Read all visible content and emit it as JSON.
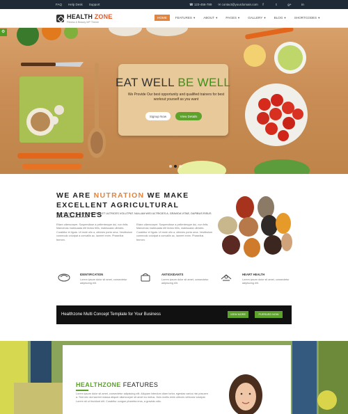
{
  "topbar": {
    "links": [
      "FAQ",
      "Help Desk",
      "Support"
    ],
    "phone": "123-456-789",
    "email": "contact@yourdomain.com",
    "social": [
      "f",
      "t",
      "g+",
      "in"
    ]
  },
  "brand": {
    "name_a": "HEALTH ",
    "name_b": "ZONE",
    "tagline": "Fitness & Beauty WP Theme"
  },
  "menu": [
    {
      "label": "HOME",
      "active": true
    },
    {
      "label": "FEATURES",
      "active": false
    },
    {
      "label": "ABOUT",
      "active": false
    },
    {
      "label": "PAGES",
      "active": false
    },
    {
      "label": "GALLERY",
      "active": false
    },
    {
      "label": "BLOG",
      "active": false
    },
    {
      "label": "SHORTCODES",
      "active": false
    }
  ],
  "hero": {
    "title_a": "EAT WELL ",
    "title_b": "BE WELL",
    "subtitle": "We Provide Our best opportunity and qualified trainers for best workout yourself as you want",
    "btn_show": "Signup Now",
    "btn_details": "View Details"
  },
  "about": {
    "title_a": "WE ARE ",
    "title_b": "NUTRATION",
    "title_c": " WE MAKE EXCELLENT AGRICULTURAL MACHINES",
    "lead": "CUM SOCIIS NATOQUE PENATIBUS ET ULTRICES VOLUTPAT. NULLAM WISI ULTRICIES A, GRAVIDA VITAE, DAPIBUS RISUS ANTE SODALES LECTUS.",
    "col1": "Etiam ullamcorper. Suspendisse a pellentesque dui, non felis. Maecenas malesuada elit lectus felis, malesuada ultricies. Curabitur et ligula. Ut mole olio a, ultricies porta urna. Vestibulum commodo volutpat a convallis ac, laoreet enim. Phasellus fermen.",
    "col2": "Etiam ullamcorper. Suspendisse a pellentesque dui, non felis. Maecenas malesuada elit lectus felis, malesuada ultricies. Curabitur et ligula. Ut mole olio a, ultricies porta urna. Vestibulum commodo volutpat a convallis ac, laoreet enim. Phasellus fermen."
  },
  "features": [
    {
      "title": "IDENTIFICATION",
      "text": "Lorem ipsum dolor sit amet, consectetur adipiscing elit."
    },
    {
      "title": "ANTIOXIDANTS",
      "text": "Lorem ipsum dolor sit amet, consectetur adipiscing elit."
    },
    {
      "title": "HEART HEALTH",
      "text": "Lorem ipsum dolor sit amet, consectetur adipiscing elit."
    }
  ],
  "cta": {
    "text": "Healthzone Multi Concept Template for Your Business",
    "btn_view": "VIEW MORE",
    "btn_purchase": "PURSUED NOW"
  },
  "bottom": {
    "title_a": "HEALTHZONE",
    "title_b": " FEATURES",
    "text": "Lorem ipsum dolor sit amet, consectetur adipiscing elit. Aliquam interdum diam tortor, egestas varius nisl posuere a. Sed nec dui laoreet massa aliquet ullamcorper sit amet eu metus. Duis mollis enim ultrices vehicula volutpat. Lorem sit ut tincidunt elit. Curabitur congue pharetra eros, a gravida odio."
  },
  "colors": {
    "accent": "#e4833a",
    "green": "#5da22b",
    "dark": "#1e2a36"
  }
}
